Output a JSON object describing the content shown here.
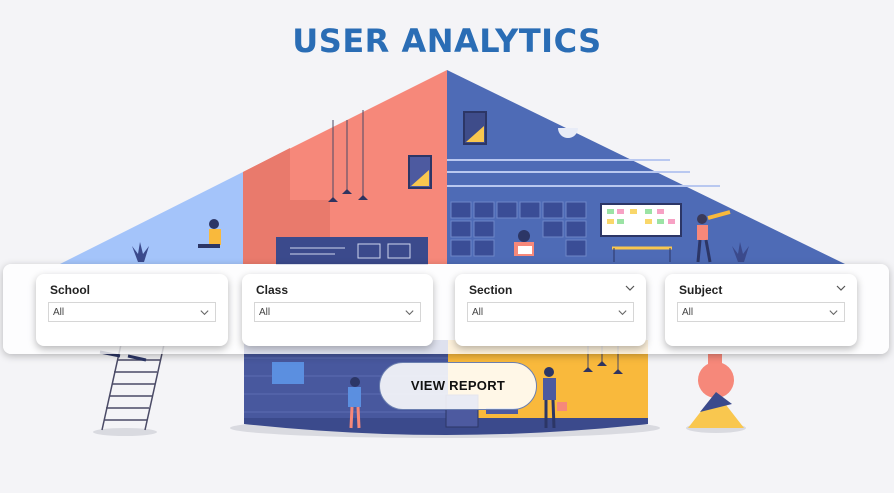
{
  "header": {
    "title": "USER ANALYTICS"
  },
  "filters": [
    {
      "label": "School",
      "value": "All"
    },
    {
      "label": "Class",
      "value": "All"
    },
    {
      "label": "Section",
      "value": "All"
    },
    {
      "label": "Subject",
      "value": "All"
    }
  ],
  "actions": {
    "view_report_label": "VIEW REPORT"
  },
  "colors": {
    "title": "#2a6db5",
    "roof_left": "#a4c4fa",
    "roof_center": "#f6887a",
    "roof_right": "#4e6bb6",
    "base_left": "#48589e",
    "base_right": "#f9b93c"
  },
  "icons": [
    "chevron-down-icon"
  ]
}
